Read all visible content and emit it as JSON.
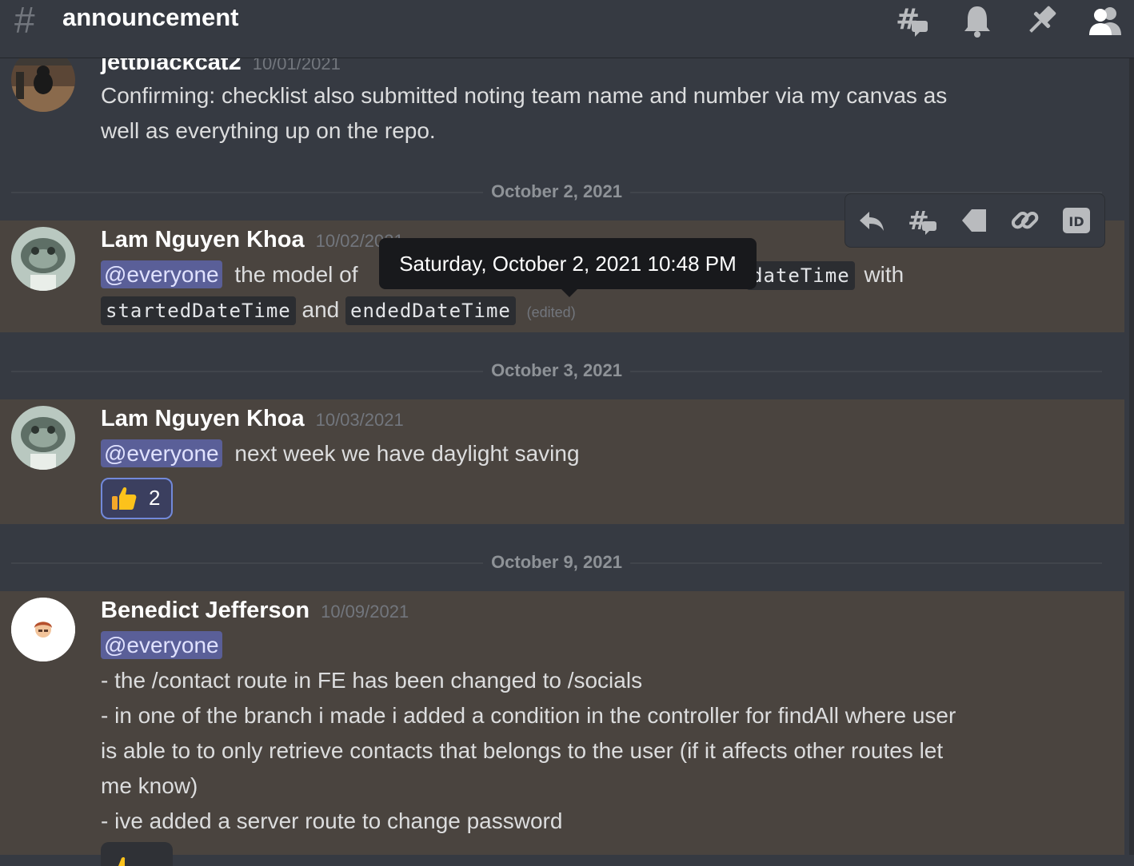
{
  "header": {
    "channel_name": "announcement"
  },
  "messages": [
    {
      "author": "jettblackcat2",
      "timestamp": "10/01/2021",
      "lines": [
        "Confirming: checklist also submitted noting team name and number via my canvas as",
        "well as everything up on the repo."
      ]
    },
    {
      "divider": "October 2, 2021"
    },
    {
      "author": "Lam Nguyen Khoa",
      "timestamp": "10/02/2021",
      "mention": "@everyone",
      "text_1": "the model of",
      "code_1": "dateTime",
      "text_2": "with",
      "code_2": "startedDateTime",
      "text_3": "and",
      "code_3": "endedDateTime",
      "edited": "(edited)"
    },
    {
      "divider": "October 3, 2021"
    },
    {
      "author": "Lam Nguyen Khoa",
      "timestamp": "10/03/2021",
      "mention": "@everyone",
      "text": "next week we have daylight saving",
      "reaction": {
        "emoji": "👍",
        "count": "2"
      }
    },
    {
      "divider": "October 9, 2021"
    },
    {
      "author": "Benedict Jefferson",
      "timestamp": "10/09/2021",
      "mention": "@everyone",
      "lines": [
        "- the /contact route in FE has been changed to /socials",
        "- in one of the branch i made i added a condition in the controller for findAll where user",
        "is able to to only retrieve contacts that belongs to the user (if it affects other routes let",
        "me know)",
        "- ive added a server route to change password"
      ]
    }
  ],
  "tooltip": "Saturday, October 2, 2021 10:48 PM",
  "icons": {
    "header": [
      "threads-icon",
      "bell-icon",
      "pin-icon",
      "members-icon"
    ],
    "toolbar": [
      "reply-icon",
      "thread-icon",
      "tag-icon",
      "link-icon",
      "copy-id-icon"
    ]
  },
  "colors": {
    "mention_bg": "#5a5f98",
    "highlight_bg": "#4a443f",
    "reaction_border": "#7289da"
  }
}
